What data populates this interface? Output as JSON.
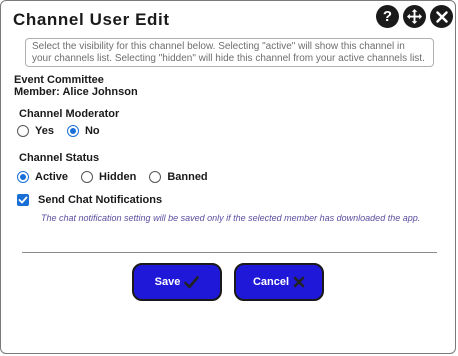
{
  "dialog": {
    "title": "Channel User Edit",
    "help_icon": "question-circle-icon",
    "move_icon": "move-arrows-icon",
    "close_icon": "close-circle-icon"
  },
  "info_text": "Select the visibility for this channel below. Selecting \"active\" will show this channel in your channels list. Selecting \"hidden\" will hide this channel from your active channels list.",
  "event": {
    "name": "Event Committee",
    "member": "Member: Alice Johnson"
  },
  "moderator": {
    "label": "Channel Moderator",
    "options": [
      "Yes",
      "No"
    ],
    "selected": "No"
  },
  "status": {
    "label": "Channel Status",
    "options": [
      "Active",
      "Hidden",
      "Banned"
    ],
    "selected": "Active"
  },
  "notifications": {
    "label": "Send Chat Notifications",
    "checked": true,
    "note": "The chat notification setting will be saved only if the selected member has downloaded the app."
  },
  "buttons": {
    "save": "Save",
    "save_icon": "checkmark-icon",
    "cancel": "Cancel",
    "cancel_icon": "x-mark-icon"
  },
  "colors": {
    "accent": "#1a6fd6",
    "button_bg": "#1f18d8",
    "note_text": "#5b4ea0"
  }
}
